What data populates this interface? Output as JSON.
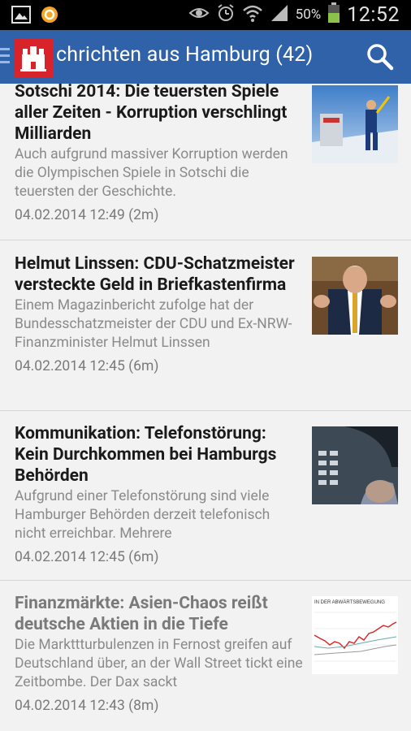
{
  "status_bar": {
    "battery_percent": "50%",
    "time": "12:52"
  },
  "header": {
    "title": "chrichten aus Hamburg (42)"
  },
  "articles": [
    {
      "title": "Sotschi 2014: Die teuersten Spiele aller Zeiten - Korruption verschlingt Milliarden",
      "snippet": "Auch aufgrund massiver Korruption werden die Olympischen Spiele in Sotschi die teuersten der Geschichte.",
      "time": "04.02.2014 12:49 (2m)",
      "read": false
    },
    {
      "title": "Helmut Linssen: CDU-Schatzmeister versteckte Geld in Briefkastenfirma",
      "snippet": "Einem Magazinbericht zufolge hat der Bundesschatzmeister der CDU und Ex-NRW-Finanzminister Helmut Linssen",
      "time": "04.02.2014 12:45 (6m)",
      "read": false
    },
    {
      "title": "Kommunikation: Telefonstörung: Kein Durchkommen bei Hamburgs Behörden",
      "snippet": "Aufgrund einer Telefonstörung sind viele Hamburger Behörden derzeit telefonisch nicht erreichbar. Mehrere",
      "time": "04.02.2014 12:45 (6m)",
      "read": false
    },
    {
      "title": "Finanzmärkte: Asien-Chaos reißt deutsche Aktien in die Tiefe",
      "snippet": "Die Markttturbulenzen in Fernost greifen auf Deutschland über, an der Wall Street tickt eine Zeitbombe. Der Dax sackt",
      "time": "04.02.2014 12:43 (8m)",
      "read": true
    }
  ],
  "thumb_chart_caption": "IN DER ABWÄRTSBEWEGUNG",
  "colors": {
    "action_bar": "#2f62a8",
    "background": "#f2f2f2",
    "title_text": "#1a1a1a",
    "read_title_text": "#7a7a7a",
    "snippet_text": "#8a8a8a"
  }
}
